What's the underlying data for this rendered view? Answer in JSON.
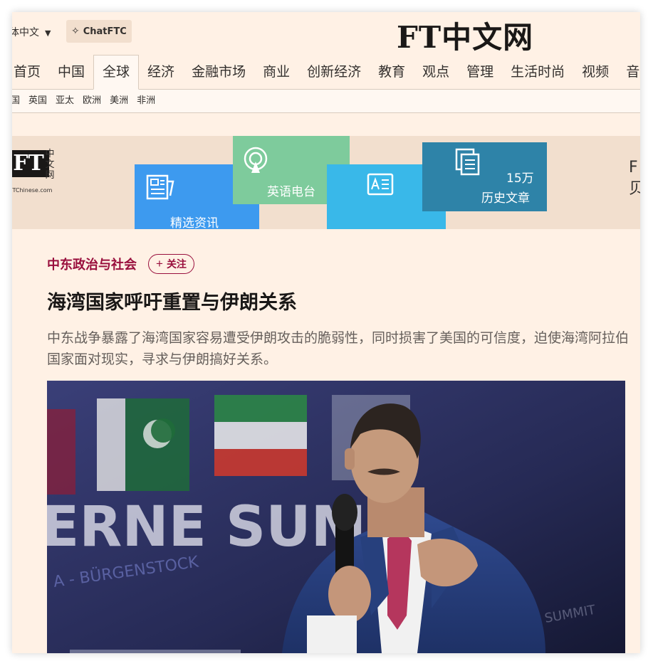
{
  "header": {
    "language": "中文",
    "language_prefix": "体",
    "chatftc_label": "ChatFTC",
    "logo_text": "FT中文网"
  },
  "nav": {
    "items": [
      {
        "label": "首页"
      },
      {
        "label": "中国"
      },
      {
        "label": "全球",
        "active": true
      },
      {
        "label": "经济"
      },
      {
        "label": "金融市场"
      },
      {
        "label": "商业"
      },
      {
        "label": "创新经济"
      },
      {
        "label": "教育"
      },
      {
        "label": "观点"
      },
      {
        "label": "管理"
      },
      {
        "label": "生活时尚"
      },
      {
        "label": "视频"
      },
      {
        "label": "音"
      }
    ],
    "subitems": [
      {
        "label": "国"
      },
      {
        "label": "英国"
      },
      {
        "label": "亚太"
      },
      {
        "label": "欧洲"
      },
      {
        "label": "美洲"
      },
      {
        "label": "非洲"
      }
    ]
  },
  "banner": {
    "ft_mark": "FT",
    "ft_cn_chars": [
      "中",
      "文",
      "网"
    ],
    "domain": "FTChinese.com",
    "tiles": [
      {
        "label": "精选资讯",
        "icon": "newspaper-icon",
        "color": "#3d9aef"
      },
      {
        "label": "英语电台",
        "icon": "radio-icon",
        "color": "#7ecb9c"
      },
      {
        "label": "",
        "icon": "bilingual-book-icon",
        "color": "#39b8e9"
      },
      {
        "label": "历史文章",
        "count": "15万",
        "icon": "documents-icon",
        "color": "#2e83a8"
      }
    ],
    "right_text": [
      "F",
      "贝"
    ]
  },
  "article": {
    "topic": "中东政治与社会",
    "follow_label": "关注",
    "headline": "海湾国家呼吁重置与伊朗关系",
    "standfirst": "中东战争暴露了海湾国家容易遭受伊朗攻击的脆弱性，同时损害了美国的可信度，迫使海湾阿拉伯国家面对现实，寻求与伊朗搞好关系。",
    "photo_backdrop_text": "ERNE SUM"
  },
  "colors": {
    "page_bg": "#fff1e5",
    "accent": "#990f3d",
    "banner_bg": "#f2dfce"
  }
}
